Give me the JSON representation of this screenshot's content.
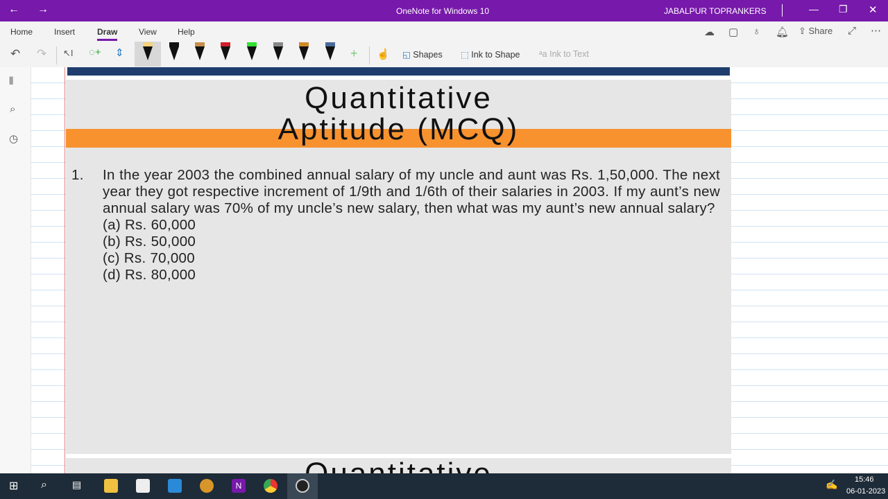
{
  "titlebar": {
    "app_title": "OneNote for Windows 10",
    "user": "JABALPUR TOPRANKERS"
  },
  "ribbon": {
    "tabs": [
      "Home",
      "Insert",
      "Draw",
      "View",
      "Help"
    ],
    "active_tab": "Draw",
    "share": "Share",
    "shapes": "Shapes",
    "ink_to_shape": "Ink to Shape",
    "ink_to_text": "Ink to Text"
  },
  "pens": [
    {
      "cap": "#f5d27a"
    },
    {
      "cap": "#111111"
    },
    {
      "cap": "#c8904a"
    },
    {
      "cap": "#d0202a"
    },
    {
      "cap": "#33e033"
    },
    {
      "cap": "#888888"
    },
    {
      "cap": "#d08a2a"
    },
    {
      "cap": "#4a6a9a"
    }
  ],
  "slide": {
    "title_line1": "Quantitative",
    "title_line2": "Aptitude (MCQ)",
    "question_number": "1.",
    "question": "In the year 2003 the combined annual salary of my uncle and aunt was Rs. 1,50,000. The next year they got respective increment of 1/9th and 1/6th of their salaries in 2003. If my aunt’s new annual salary was 70% of my uncle’s new salary, then what was my aunt’s new annual salary?",
    "options": [
      "(a) Rs. 60,000",
      "(b) Rs. 50,000",
      "(c) Rs. 70,000",
      "(d) Rs. 80,000"
    ],
    "next_slide_title": "Quantitative"
  },
  "taskbar": {
    "time": "15:46",
    "date": "06-01-2023"
  }
}
